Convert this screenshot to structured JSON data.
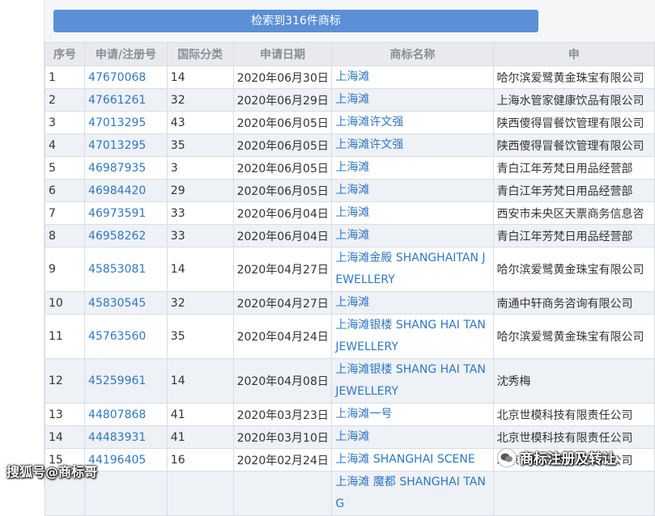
{
  "banner": {
    "label": "检索到316件商标"
  },
  "table": {
    "headers": [
      "序号",
      "申请/注册号",
      "国际分类",
      "申请日期",
      "商标名称",
      "申"
    ],
    "rows": [
      {
        "no": "1",
        "reg": "47670068",
        "cls": "14",
        "date": "2020年06月30日",
        "name": "上海滩",
        "owner": "哈尔滨爱鹭黄金珠宝有限公司"
      },
      {
        "no": "2",
        "reg": "47661261",
        "cls": "32",
        "date": "2020年06月29日",
        "name": "上海滩",
        "owner": "上海水管家健康饮品有限公司"
      },
      {
        "no": "3",
        "reg": "47013295",
        "cls": "43",
        "date": "2020年06月05日",
        "name": "上海滩许文强",
        "owner": "陕西傻得冒餐饮管理有限公司"
      },
      {
        "no": "4",
        "reg": "47013295",
        "cls": "35",
        "date": "2020年06月05日",
        "name": "上海滩许文强",
        "owner": "陕西傻得冒餐饮管理有限公司"
      },
      {
        "no": "5",
        "reg": "46987935",
        "cls": "3",
        "date": "2020年06月05日",
        "name": "上海滩",
        "owner": "青白江年芳梵日用品经营部"
      },
      {
        "no": "6",
        "reg": "46984420",
        "cls": "29",
        "date": "2020年06月05日",
        "name": "上海滩",
        "owner": "青白江年芳梵日用品经营部"
      },
      {
        "no": "7",
        "reg": "46973591",
        "cls": "33",
        "date": "2020年06月04日",
        "name": "上海滩",
        "owner": "西安市未央区天票商务信息咨"
      },
      {
        "no": "8",
        "reg": "46958262",
        "cls": "33",
        "date": "2020年06月04日",
        "name": "上海滩",
        "owner": "青白江年芳梵日用品经营部"
      },
      {
        "no": "9",
        "reg": "45853081",
        "cls": "14",
        "date": "2020年04月27日",
        "name": "上海滩金殿 SHANGHAITAN JEWELLERY",
        "owner": "哈尔滨爱鹭黄金珠宝有限公司"
      },
      {
        "no": "10",
        "reg": "45830545",
        "cls": "32",
        "date": "2020年04月27日",
        "name": "上海滩",
        "owner": "南通中轩商务咨询有限公司"
      },
      {
        "no": "11",
        "reg": "45763560",
        "cls": "35",
        "date": "2020年04月24日",
        "name": "上海滩银楼 SHANG HAI TAN JEWELLERY",
        "owner": "哈尔滨爱鹭黄金珠宝有限公司"
      },
      {
        "no": "12",
        "reg": "45259961",
        "cls": "14",
        "date": "2020年04月08日",
        "name": "上海滩银楼 SHANG HAI TAN JEWELLERY",
        "owner": "沈秀梅"
      },
      {
        "no": "13",
        "reg": "44807868",
        "cls": "41",
        "date": "2020年03月23日",
        "name": "上海滩一号",
        "owner": "北京世模科技有限责任公司"
      },
      {
        "no": "14",
        "reg": "44483931",
        "cls": "41",
        "date": "2020年03月10日",
        "name": "上海滩",
        "owner": "北京世模科技有限责任公司"
      },
      {
        "no": "15",
        "reg": "44196405",
        "cls": "16",
        "date": "2020年02月24日",
        "name": "上海滩 SHANGHAI SCENE",
        "owner": "北京世模科技有限责任公司"
      },
      {
        "no": "",
        "reg": "",
        "cls": "",
        "date": "",
        "name": "上海滩 魔都 SHANGHAI TANG",
        "owner": ""
      }
    ]
  },
  "watermark": {
    "left": "搜狐号@商标哥",
    "right": "商标注册及转让",
    "icon": "wechat-icon"
  }
}
